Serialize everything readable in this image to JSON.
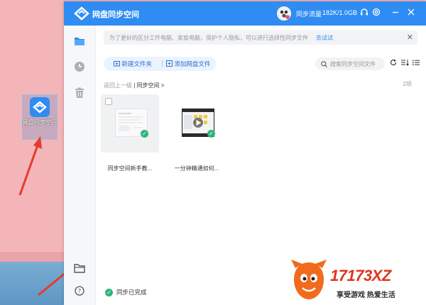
{
  "desktop": {
    "icon_label": "网盘同步空间"
  },
  "window": {
    "title": "网盘同步空间",
    "sync_label": "同步流量",
    "sync_value": "182K/1.0GB",
    "icons": [
      "headset-icon",
      "settings-icon",
      "minimize-icon",
      "close-icon"
    ]
  },
  "sidebar": {
    "items": [
      "files-icon",
      "history-icon",
      "trash-icon",
      "folder-icon",
      "help-icon"
    ]
  },
  "notice": {
    "text": "为了更好的区分工作电脑、家庭电脑，保护个人隐私，可以进行选择性同步文件",
    "link": "去试试",
    "close": "✕"
  },
  "toolbar": {
    "new_folder": "新建文件夹",
    "add_cloud_file": "添加网盘文件",
    "search_placeholder": "搜索同步空间文件"
  },
  "breadcrumb": {
    "back": "返回上一级",
    "current": "同步空间"
  },
  "file_count": "2项",
  "files": [
    {
      "name": "同步空间新手教..."
    },
    {
      "name": "一分钟精通如何..."
    }
  ],
  "status": "同步已完成",
  "watermark": {
    "brand": "17173XZ",
    "slogan": "享受游戏  热爱生活"
  },
  "colors": {
    "accent": "#2f8cf2",
    "success": "#31b37d",
    "watermark": "#e0341f"
  }
}
